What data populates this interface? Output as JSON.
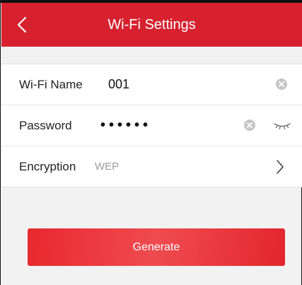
{
  "header": {
    "title": "Wi-Fi Settings"
  },
  "form": {
    "wifi_name": {
      "label": "Wi-Fi Name",
      "value": "001"
    },
    "password": {
      "label": "Password",
      "masked_value": "••••••"
    },
    "encryption": {
      "label": "Encryption",
      "value": "WEP"
    }
  },
  "actions": {
    "generate_label": "Generate"
  },
  "colors": {
    "brand_red": "#d7212e",
    "button_red": "#ec3a3f",
    "background": "#f2f2f2"
  },
  "icons": {
    "back": "chevron-left-icon",
    "clear": "clear-circle-icon",
    "password_visibility": "eye-closed-icon",
    "encryption_open": "chevron-right-icon"
  }
}
